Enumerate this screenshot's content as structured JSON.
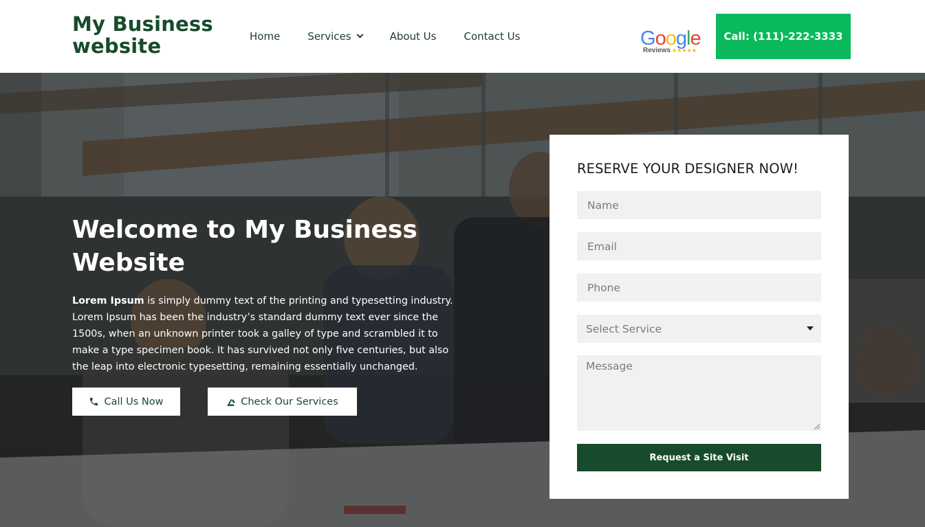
{
  "header": {
    "logo": "My Business website",
    "nav": [
      {
        "label": "Home"
      },
      {
        "label": "Services",
        "has_dropdown": true
      },
      {
        "label": "About Us"
      },
      {
        "label": "Contact Us"
      }
    ],
    "google_badge": {
      "letters": [
        "G",
        "o",
        "o",
        "g",
        "l",
        "e"
      ],
      "letter_colors": [
        "#4285F4",
        "#EA4335",
        "#FBBC05",
        "#4285F4",
        "#34A853",
        "#EA4335"
      ],
      "sub_label": "Reviews",
      "stars": "★★★★★"
    },
    "call_button": "Call: (111)-222-3333"
  },
  "hero": {
    "title": "Welcome to My Business Website",
    "text_bold": "Lorem Ipsum",
    "text_rest": " is simply dummy text of the printing and typesetting industry. Lorem Ipsum has been the industry’s standard dummy text ever since the 1500s, when an unknown printer took a galley of type and scrambled it to make a type specimen book. It has survived not only five centuries, but also the leap into electronic typesetting, remaining essentially unchanged.",
    "buttons": {
      "call": {
        "label": "Call Us Now",
        "icon": "phone-icon"
      },
      "services": {
        "label": "Check Our Services",
        "icon": "tools-icon"
      }
    }
  },
  "form": {
    "title": "RESERVE YOUR DESIGNER NOW!",
    "name_placeholder": "Name",
    "email_placeholder": "Email",
    "phone_placeholder": "Phone",
    "service_select": "Select Service",
    "message_placeholder": "Message",
    "submit": "Request a Site Visit"
  },
  "colors": {
    "brand_dark_green": "#174b2b",
    "call_green": "#0ab95b",
    "field_bg": "#f1f1f1"
  }
}
